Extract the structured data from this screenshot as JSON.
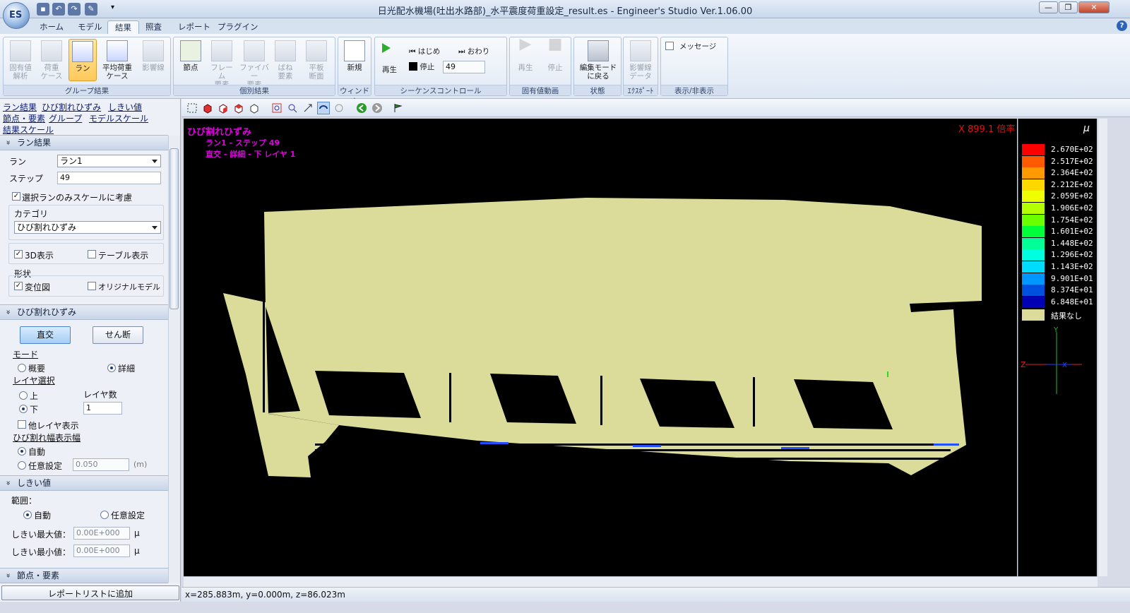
{
  "window": {
    "title": "日光配水機場(吐出水路部)_水平震度荷重設定_result.es - Engineer's Studio Ver.1.06.00",
    "app_logo": "ES"
  },
  "tabs": [
    {
      "label": "ホーム"
    },
    {
      "label": "モデル"
    },
    {
      "label": "結果",
      "active": true
    },
    {
      "label": "照査"
    },
    {
      "label": "レポート"
    },
    {
      "label": "プラグイン"
    }
  ],
  "ribbon": {
    "group_result": {
      "label": "グループ結果",
      "buttons": [
        {
          "label": "固有値\n解析",
          "enabled": false
        },
        {
          "label": "荷重\nケース",
          "enabled": false
        },
        {
          "label": "ラン",
          "selected": true
        },
        {
          "label": "平均荷重\nケース"
        },
        {
          "label": "影響線",
          "enabled": false
        }
      ]
    },
    "individual": {
      "label": "個別結果",
      "buttons": [
        {
          "label": "節点"
        },
        {
          "label": "フレーム\n要素",
          "enabled": false
        },
        {
          "label": "ファイバー\n要素",
          "enabled": false
        },
        {
          "label": "ばね\n要素",
          "enabled": false
        },
        {
          "label": "平板\n断面",
          "enabled": false
        }
      ]
    },
    "window": {
      "label": "ウィンドウ",
      "new_label": "新規"
    },
    "sequence": {
      "label": "シーケンスコントロール",
      "play": "再生",
      "start": "はじめ",
      "end": "おわり",
      "stop": "停止",
      "step": "49"
    },
    "eigen_anim": {
      "label": "固有値動画",
      "play": "再生",
      "stop": "停止"
    },
    "state": {
      "label": "状態",
      "edit_mode": "編集モード\nに戻る"
    },
    "export": {
      "label": "ｴｸｽﾎﾟｰﾄ",
      "influence": "影響線\nデータ"
    },
    "display": {
      "label": "表示/非表示",
      "message": "メッセージ"
    }
  },
  "nav_links": [
    "ラン結果",
    "ひび割れひずみ",
    "しきい値",
    "節点・要素",
    "グループ",
    "モデルスケール",
    "結果スケール"
  ],
  "panel": {
    "run_result": {
      "header": "ラン結果",
      "run_label": "ラン",
      "run_value": "ラン1",
      "step_label": "ステップ",
      "step_value": "49",
      "scale_check": "選択ランのみスケールに考慮",
      "category_label": "カテゴリ",
      "category_value": "ひび割れひずみ",
      "show3d": "3D表示",
      "table": "テーブル表示",
      "shape_label": "形状",
      "disp": "変位図",
      "original": "オリジナルモデル"
    },
    "crack": {
      "header": "ひび割れひずみ",
      "btn_orth": "直交",
      "btn_shear": "せん断",
      "mode_label": "モード",
      "mode_summary": "概要",
      "mode_detail": "詳細",
      "layer_label": "レイヤ選択",
      "layer_top": "上",
      "layer_bottom": "下",
      "layer_count_label": "レイヤ数",
      "layer_count": "1",
      "other_layer": "他レイヤ表示",
      "width_label": "ひび割れ幅表示幅",
      "auto": "自動",
      "manual": "任意設定",
      "width_value": "0.050",
      "width_unit": "(m)"
    },
    "threshold": {
      "header": "しきい値",
      "range_label": "範囲：",
      "auto": "自動",
      "manual": "任意設定",
      "max_label": "しきい最大値：",
      "max_value": "0.00E+000",
      "min_label": "しきい最小値：",
      "min_value": "0.00E+000",
      "unit": "μ"
    },
    "node": {
      "header": "節点・要素"
    },
    "add_report": "レポートリストに追加"
  },
  "view": {
    "title": "ひび割れひずみ",
    "sub1": "ラン1 - ステップ 49",
    "sub2": "直交 - 詳細 - 下 レイヤ 1",
    "scale": "X 899.1 倍率"
  },
  "legend": {
    "unit": "μ",
    "entries": [
      {
        "value": "2.670E+02",
        "color": "#ff0000"
      },
      {
        "value": "2.517E+02",
        "color": "#ff5a00"
      },
      {
        "value": "2.364E+02",
        "color": "#ff9a00"
      },
      {
        "value": "2.212E+02",
        "color": "#ffd800"
      },
      {
        "value": "2.059E+02",
        "color": "#f0ff00"
      },
      {
        "value": "1.906E+02",
        "color": "#b4ff00"
      },
      {
        "value": "1.754E+02",
        "color": "#6cff00"
      },
      {
        "value": "1.601E+02",
        "color": "#00ff3a"
      },
      {
        "value": "1.448E+02",
        "color": "#00ff96"
      },
      {
        "value": "1.296E+02",
        "color": "#00ffe0"
      },
      {
        "value": "1.143E+02",
        "color": "#00dcff"
      },
      {
        "value": "9.901E+01",
        "color": "#0096ff"
      },
      {
        "value": "8.374E+01",
        "color": "#0050e0"
      },
      {
        "value": "6.848E+01",
        "color": "#0000b4"
      }
    ],
    "no_result": "結果なし",
    "no_result_color": "#dcdc9a",
    "axis_y": "Y",
    "axis_z": "Z",
    "axis_x": "X"
  },
  "status": {
    "coords": "x=285.883m, y=0.000m, z=86.023m"
  }
}
